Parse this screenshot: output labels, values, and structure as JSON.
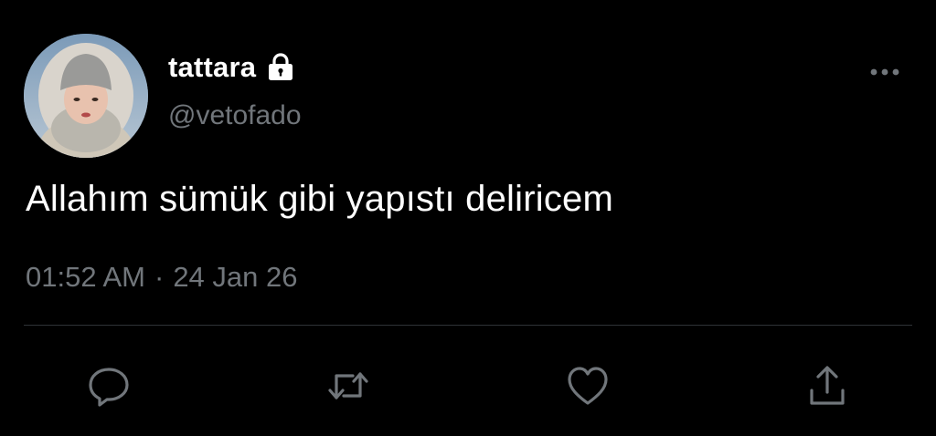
{
  "tweet": {
    "display_name": "tattara",
    "handle": "@vetofado",
    "text": "Allahım sümük gibi yapıstı deliricem",
    "time": "01:52 AM",
    "separator": "·",
    "date": "24 Jan 26"
  },
  "icons": {
    "lock": "lock-icon",
    "more": "more-icon",
    "reply": "reply-icon",
    "retweet": "retweet-icon",
    "like": "heart-icon",
    "share": "share-icon"
  },
  "colors": {
    "background": "#000000",
    "text_primary": "#ffffff",
    "text_secondary": "#71767b",
    "divider": "#2f3336"
  }
}
